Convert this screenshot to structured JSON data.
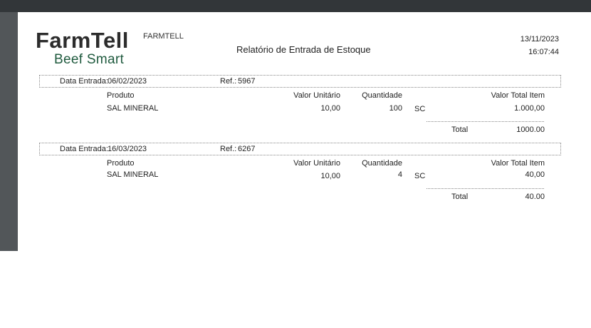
{
  "header": {
    "logo_main": "FarmTell",
    "logo_sub": "Beef Smart",
    "company": "FARMTELL",
    "title": "Relatório de Entrada de Estoque",
    "date": "13/11/2023",
    "time": "16:07:44"
  },
  "labels": {
    "data_entrada": "Data Entrada:",
    "ref": "Ref.:",
    "produto": "Produto",
    "valor_unitario": "Valor Unitário",
    "quantidade": "Quantidade",
    "valor_total_item": "Valor Total Item",
    "total": "Total"
  },
  "entries": [
    {
      "date": "06/02/2023",
      "ref": "5967",
      "product": "SAL MINERAL",
      "unit_value": "10,00",
      "quantity": "100",
      "unit": "SC",
      "item_total": "1.000,00",
      "total": "1000.00"
    },
    {
      "date": "16/03/2023",
      "ref": "6267",
      "product": "SAL MINERAL",
      "unit_value": "10,00",
      "quantity": "4",
      "unit": "SC",
      "item_total": "40,00",
      "total": "40.00"
    }
  ]
}
